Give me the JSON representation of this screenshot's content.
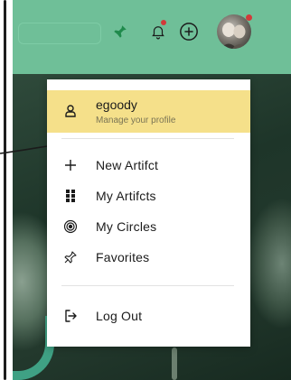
{
  "header": {
    "colors": {
      "bar": "#6fbf98",
      "pin_icon": "#1f8a4c",
      "notification_dot": "#d23a3a"
    },
    "icons": [
      "pin-icon",
      "bell-icon",
      "add-circle-icon",
      "avatar"
    ]
  },
  "menu": {
    "profile": {
      "name": "egoody",
      "subtitle": "Manage your profile",
      "icon": "user-icon",
      "highlight_color": "#f5e08a"
    },
    "items": [
      {
        "label": "New Artifct",
        "icon": "plus-icon"
      },
      {
        "label": "My Artifcts",
        "icon": "grid-icon"
      },
      {
        "label": "My Circles",
        "icon": "target-icon"
      },
      {
        "label": "Favorites",
        "icon": "pin-outline-icon"
      }
    ],
    "logout": {
      "label": "Log Out",
      "icon": "logout-icon"
    }
  }
}
